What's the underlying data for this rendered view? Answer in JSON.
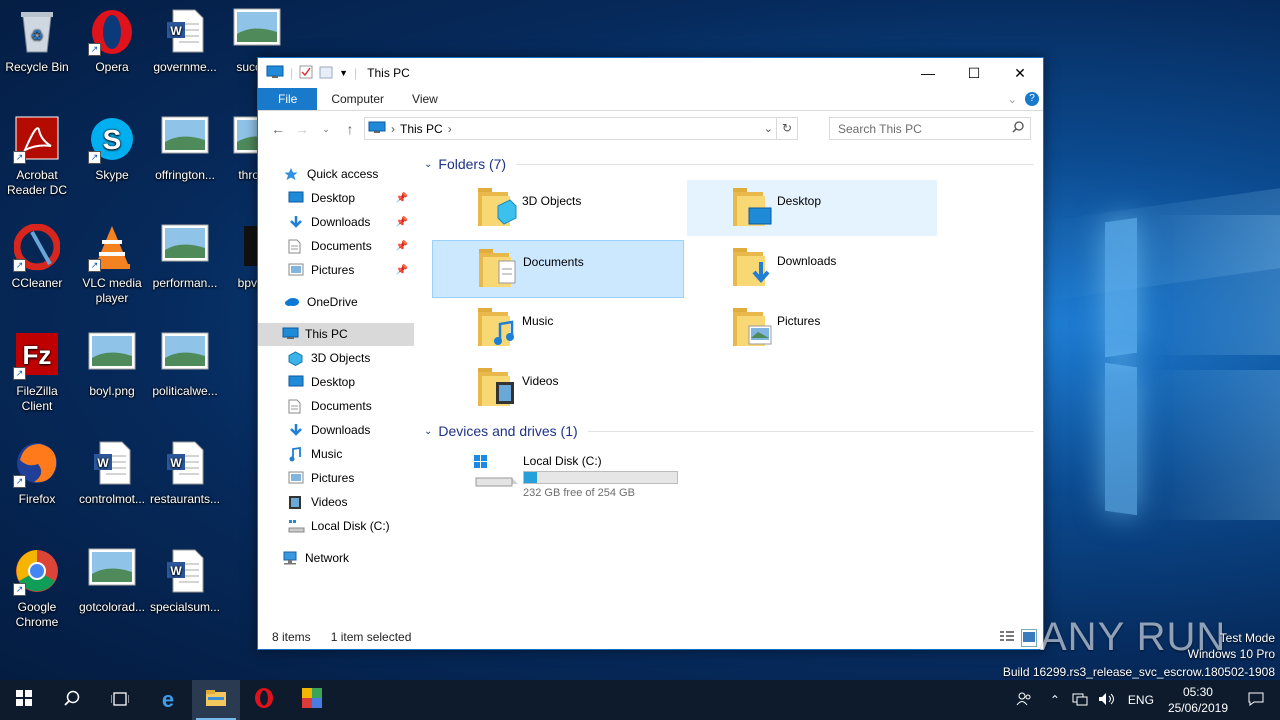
{
  "desktop": {
    "icons": [
      {
        "label": "Recycle Bin",
        "icon": "recycle-bin-icon"
      },
      {
        "label": "Opera",
        "icon": "opera-icon"
      },
      {
        "label": "governme...",
        "icon": "word-doc-icon"
      },
      {
        "label": "succe...",
        "icon": "image-file-icon"
      },
      {
        "label": "Acrobat Reader DC",
        "icon": "acrobat-icon"
      },
      {
        "label": "Skype",
        "icon": "skype-icon"
      },
      {
        "label": "offrington...",
        "icon": "image-file-icon"
      },
      {
        "label": "throu...",
        "icon": "image-file-icon"
      },
      {
        "label": "CCleaner",
        "icon": "ccleaner-icon"
      },
      {
        "label": "VLC media player",
        "icon": "vlc-icon"
      },
      {
        "label": "performan...",
        "icon": "image-file-icon"
      },
      {
        "label": "bpvpl...",
        "icon": "file-icon"
      },
      {
        "label": "FileZilla Client",
        "icon": "filezilla-icon"
      },
      {
        "label": "boyl.png",
        "icon": "image-file-icon"
      },
      {
        "label": "politicalwe...",
        "icon": "image-file-icon"
      },
      {
        "label": "Firefox",
        "icon": "firefox-icon"
      },
      {
        "label": "controlmot...",
        "icon": "word-doc-icon"
      },
      {
        "label": "restaurants...",
        "icon": "word-doc-icon"
      },
      {
        "label": "Google Chrome",
        "icon": "chrome-icon"
      },
      {
        "label": "gotcolorad...",
        "icon": "image-file-icon"
      },
      {
        "label": "specialsum...",
        "icon": "word-doc-icon"
      }
    ]
  },
  "explorer": {
    "title": "This PC",
    "ribbon_tabs": [
      "File",
      "Computer",
      "View"
    ],
    "address": {
      "location": "This PC"
    },
    "search": {
      "placeholder": "Search This PC"
    },
    "nav": {
      "quick_access": "Quick access",
      "quick_items": [
        "Desktop",
        "Downloads",
        "Documents",
        "Pictures"
      ],
      "onedrive": "OneDrive",
      "this_pc": "This PC",
      "pc_items": [
        "3D Objects",
        "Desktop",
        "Documents",
        "Downloads",
        "Music",
        "Pictures",
        "Videos",
        "Local Disk (C:)"
      ],
      "network": "Network"
    },
    "folders_header": "Folders (7)",
    "folders": [
      "3D Objects",
      "Desktop",
      "Documents",
      "Downloads",
      "Music",
      "Pictures",
      "Videos"
    ],
    "devices_header": "Devices and drives (1)",
    "drive": {
      "name": "Local Disk (C:)",
      "free_text": "232 GB free of 254 GB",
      "used_fraction": 0.087
    },
    "status": {
      "items": "8 items",
      "selected": "1 item selected"
    }
  },
  "watermark": {
    "brand": "ANY RUN",
    "lines": [
      "Test Mode",
      "Windows 10 Pro",
      "Build 16299.rs3_release_svc_escrow.180502-1908"
    ]
  },
  "taskbar": {
    "language": "ENG",
    "time": "05:30",
    "date": "25/06/2019"
  }
}
